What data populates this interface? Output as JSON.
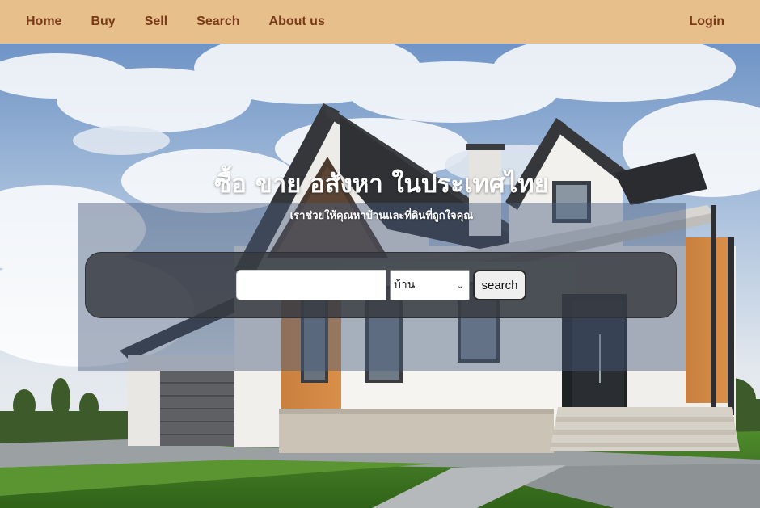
{
  "nav": {
    "home": "Home",
    "buy": "Buy",
    "sell": "Sell",
    "search": "Search",
    "about": "About us",
    "login": "Login"
  },
  "hero": {
    "title": "ซื้อ ขาย อสังหา ในประเทศไทย",
    "subtitle": "เราช่วยให้คุณหาบ้านและที่ดินที่ถูกใจคุณ",
    "search_value": "",
    "select_value": "บ้าน",
    "search_button": "search"
  },
  "colors": {
    "navbar": "#e6bf8b",
    "nav_text": "#7a3a17",
    "overlay": "#465a7d",
    "search_panel": "#373940"
  },
  "icons": {
    "select_chevron": "chevron-down-icon",
    "background": "house-photo"
  }
}
